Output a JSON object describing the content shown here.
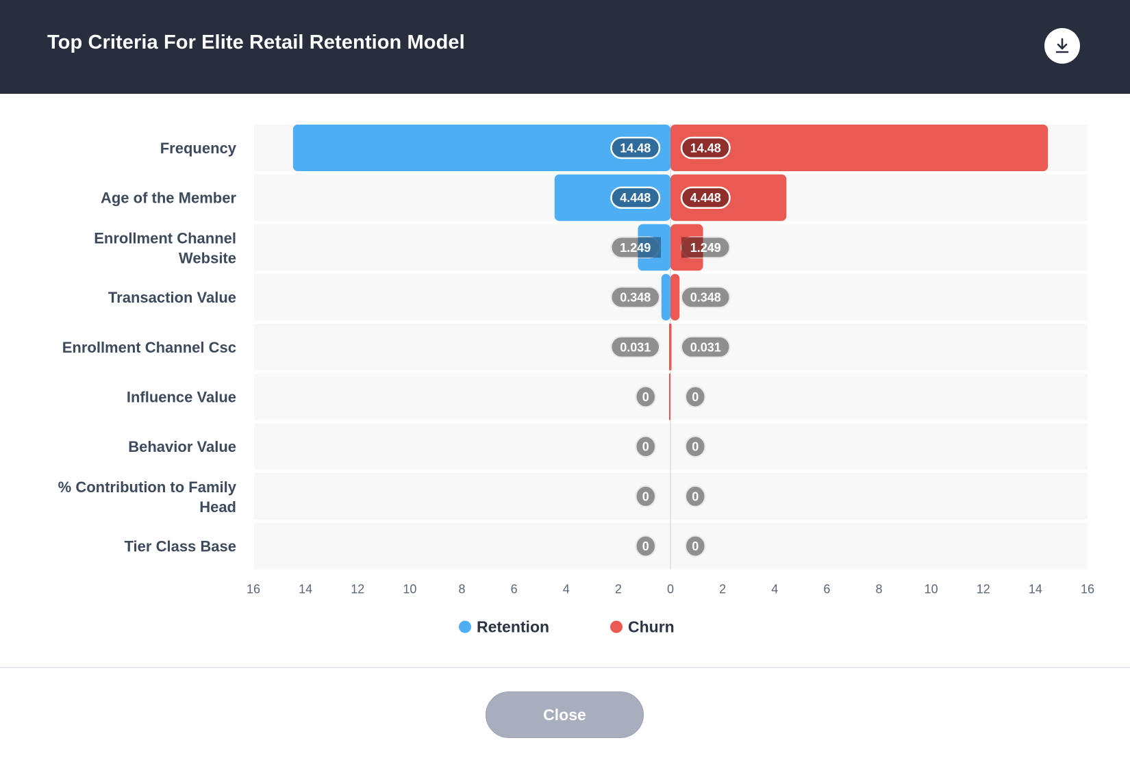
{
  "header": {
    "title": "Top Criteria For Elite Retail Retention Model",
    "download_icon": "download-icon"
  },
  "colors": {
    "retention": "#4daef4",
    "churn": "#e95a52",
    "retention_label": "#2e6a9a",
    "churn_label": "#8f2e2a",
    "neutral_label": "#8f8f8f",
    "row_bg": "#f8f8f8",
    "header_bg": "#282e3d"
  },
  "chart_data": {
    "type": "bar",
    "orientation": "horizontal-diverging",
    "title": "",
    "xlabel": "",
    "ylabel": "",
    "xlim": [
      -16,
      16
    ],
    "x_ticks": [
      16,
      14,
      12,
      10,
      8,
      6,
      4,
      2,
      0,
      2,
      4,
      6,
      8,
      10,
      12,
      14,
      16
    ],
    "categories": [
      [
        "Frequency"
      ],
      [
        "Age of the Member"
      ],
      [
        "Enrollment Channel",
        "Website"
      ],
      [
        "Transaction Value"
      ],
      [
        "Enrollment Channel Csc"
      ],
      [
        "Influence Value"
      ],
      [
        "Behavior Value"
      ],
      [
        "% Contribution to Family",
        "Head"
      ],
      [
        "Tier Class Base"
      ]
    ],
    "series": [
      {
        "name": "Retention",
        "side": "left",
        "values": [
          14.48,
          4.448,
          1.249,
          0.348,
          0.031,
          0,
          0,
          0,
          0
        ],
        "labels": [
          "14.48",
          "4.448",
          "1.249",
          "0.348",
          "0.031",
          "0",
          "0",
          "0",
          "0"
        ]
      },
      {
        "name": "Churn",
        "side": "right",
        "values": [
          14.48,
          4.448,
          1.249,
          0.348,
          0.031,
          0,
          0,
          0,
          0
        ],
        "labels": [
          "14.48",
          "4.448",
          "1.249",
          "0.348",
          "0.031",
          "0",
          "0",
          "0",
          "0"
        ]
      }
    ],
    "legend": {
      "position": "bottom-center",
      "entries": [
        "Retention",
        "Churn"
      ]
    },
    "grid": false
  },
  "footer": {
    "close_label": "Close"
  }
}
